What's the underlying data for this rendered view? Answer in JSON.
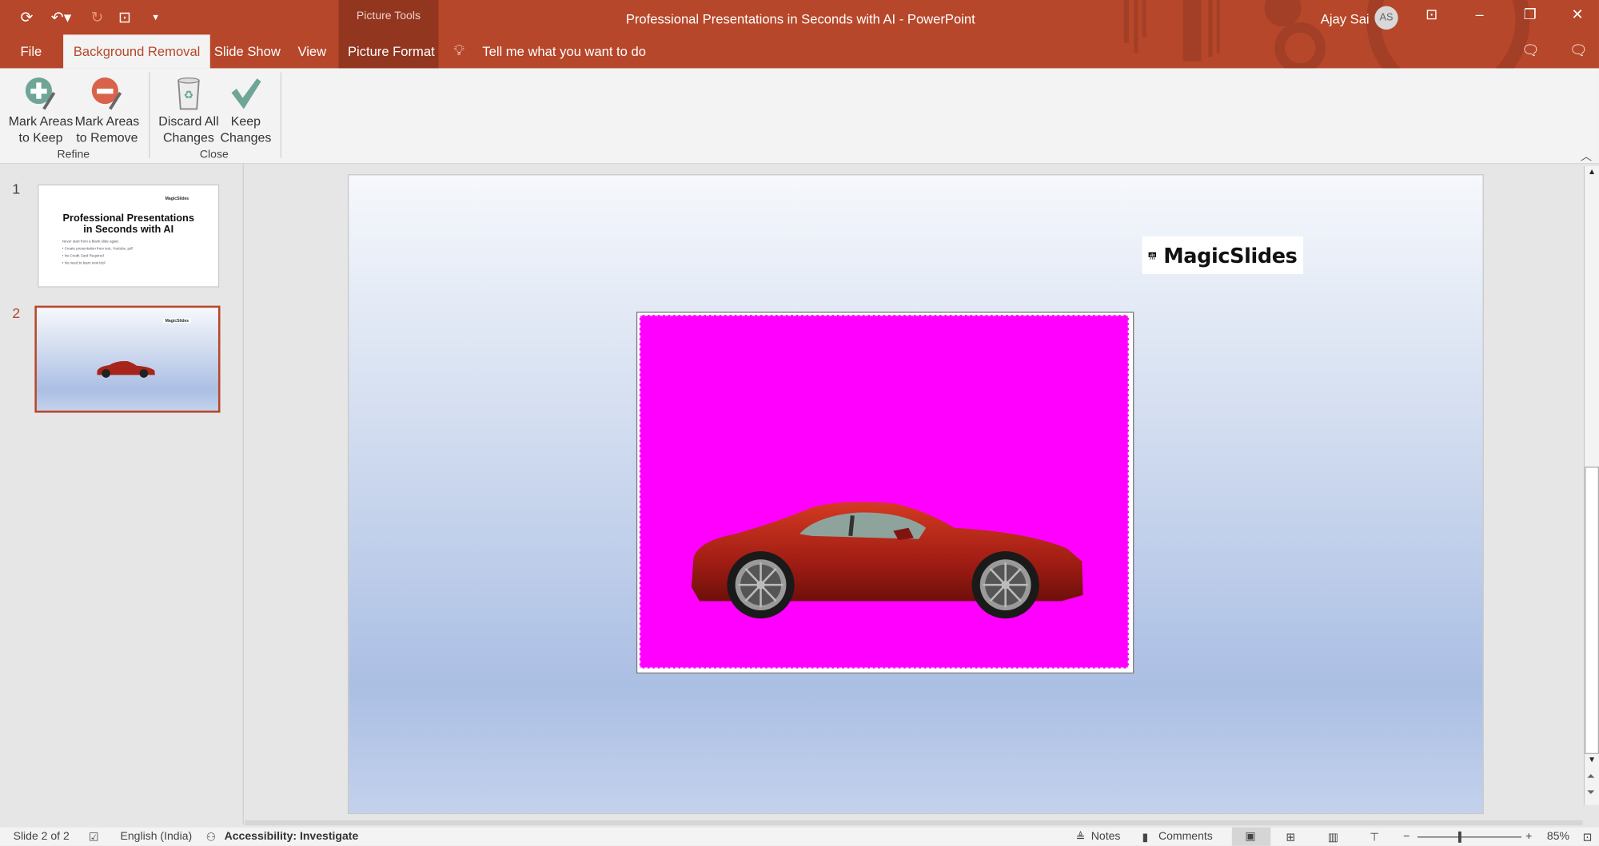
{
  "window": {
    "title": "Professional Presentations in Seconds with AI  -  PowerPoint",
    "user": "Ajay Sai",
    "avatar_initials": "AS",
    "context_group": "Picture Tools"
  },
  "quick_access": [
    "save-icon",
    "undo-icon",
    "redo-icon",
    "present-icon",
    "customize-icon"
  ],
  "tabs": [
    {
      "label": "File"
    },
    {
      "label": "Background Removal",
      "active": true
    },
    {
      "label": "Slide Show"
    },
    {
      "label": "View"
    },
    {
      "label": "Picture Format"
    }
  ],
  "tell_me": "Tell me what you want to do",
  "ribbon": {
    "groups": [
      {
        "label": "Refine"
      },
      {
        "label": "Close"
      }
    ],
    "buttons": [
      {
        "line1": "Mark Areas",
        "line2": "to Keep",
        "icon": "plus-pencil-icon"
      },
      {
        "line1": "Mark Areas",
        "line2": "to Remove",
        "icon": "minus-pencil-icon"
      },
      {
        "line1": "Discard All",
        "line2": "Changes",
        "icon": "recycle-bin-icon"
      },
      {
        "line1": "Keep",
        "line2": "Changes",
        "icon": "checkmark-icon"
      }
    ]
  },
  "slides": [
    {
      "number": "1",
      "title_line1": "Professional Presentations",
      "title_line2": "in Seconds with AI",
      "bullets": [
        "Never start from a blank slide again.",
        "• Create presentation from text, Youtube, pdf",
        "• No Credit Card Required",
        "• No need to learn new tool"
      ],
      "logo": "MagicSlides"
    },
    {
      "number": "2",
      "selected": true,
      "logo": "MagicSlides"
    }
  ],
  "canvas": {
    "logo_text": "MagicSlides",
    "removal_color": "#FF00FF"
  },
  "status": {
    "slide": "Slide 2 of 2",
    "language": "English (India)",
    "accessibility": "Accessibility: Investigate",
    "notes": "Notes",
    "comments": "Comments",
    "zoom": "85%",
    "zoom_percent": 85
  },
  "colors": {
    "accent": "#B7472A",
    "context_tab": "#923620",
    "ribbon": "#F3F3F3"
  }
}
